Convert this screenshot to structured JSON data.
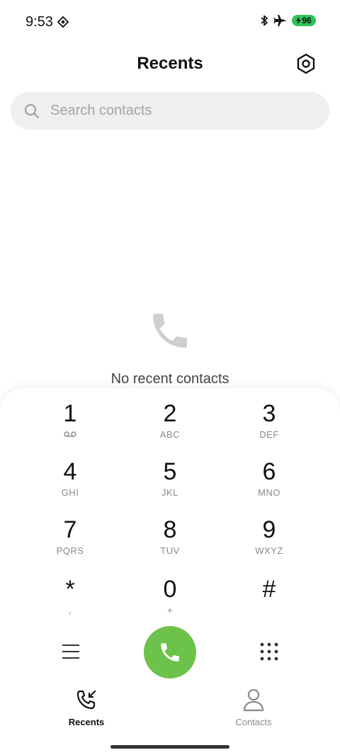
{
  "status": {
    "time": "9:53",
    "battery": "96"
  },
  "header": {
    "title": "Recents"
  },
  "search": {
    "placeholder": "Search contacts"
  },
  "empty_state": {
    "message": "No recent contacts"
  },
  "dialpad": {
    "keys": [
      {
        "digit": "1",
        "letters": ""
      },
      {
        "digit": "2",
        "letters": "ABC"
      },
      {
        "digit": "3",
        "letters": "DEF"
      },
      {
        "digit": "4",
        "letters": "GHI"
      },
      {
        "digit": "5",
        "letters": "JKL"
      },
      {
        "digit": "6",
        "letters": "MNO"
      },
      {
        "digit": "7",
        "letters": "PQRS"
      },
      {
        "digit": "8",
        "letters": "TUV"
      },
      {
        "digit": "9",
        "letters": "WXYZ"
      },
      {
        "digit": "*",
        "letters": ","
      },
      {
        "digit": "0",
        "letters": "+"
      },
      {
        "digit": "#",
        "letters": ""
      }
    ]
  },
  "nav": {
    "recents": "Recents",
    "contacts": "Contacts"
  },
  "colors": {
    "call_green": "#6cc24a",
    "battery_green": "#2fc15a",
    "search_bg": "#efefef"
  }
}
